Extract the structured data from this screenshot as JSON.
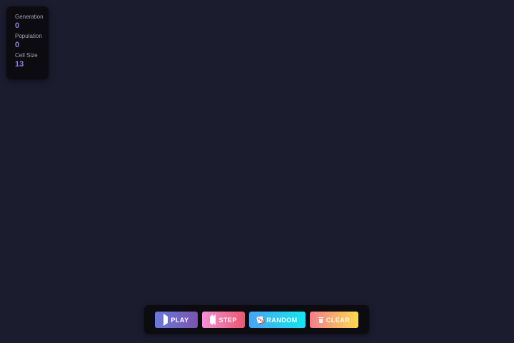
{
  "stats": {
    "generation_label": "Generation",
    "generation_value": "0",
    "population_label": "Population",
    "population_value": "0",
    "cell_size_label": "Cell Size",
    "cell_size_value": "13"
  },
  "controls": {
    "play_label": "PLAY",
    "step_label": "STEP",
    "random_label": "RANDOM",
    "clear_label": "CLEAR"
  },
  "icons": {
    "play": "play-icon",
    "step": "step-icon",
    "random": "dice-icon",
    "clear": "trash-icon"
  },
  "colors": {
    "background": "#1b1c2e",
    "panel": "#0b0b10",
    "accent_value": "#8c83e8"
  }
}
